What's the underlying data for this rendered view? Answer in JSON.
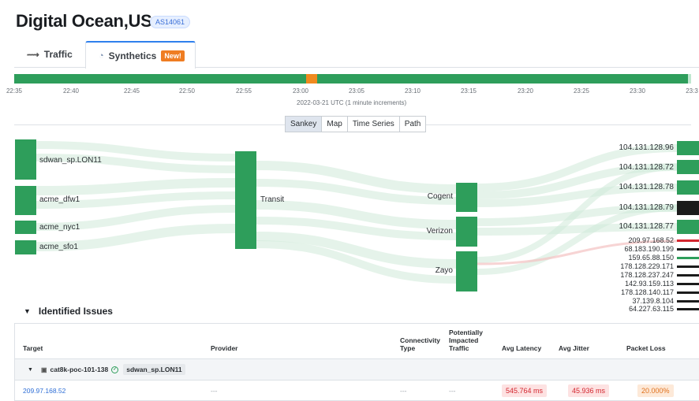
{
  "header": {
    "title": "Digital Ocean,US",
    "asn_badge": "AS14061",
    "tabs": [
      {
        "label": "Traffic",
        "icon": "traffic-icon"
      },
      {
        "label": "Synthetics",
        "icon": "synthetics-icon",
        "badge": "New!"
      }
    ]
  },
  "timeline": {
    "ticks": [
      "22:35",
      "22:40",
      "22:45",
      "22:50",
      "22:55",
      "23:00",
      "23:05",
      "23:10",
      "23:15",
      "23:20",
      "23:25",
      "23:30",
      "23:3"
    ],
    "axis_label": "2022-03-21 UTC (1 minute increments)"
  },
  "view_tabs": [
    "Sankey",
    "Map",
    "Time Series",
    "Path"
  ],
  "sankey": {
    "sources": [
      "sdwan_sp.LON11",
      "acme_dfw1",
      "acme_nyc1",
      "acme_sfo1"
    ],
    "middle": "Transit",
    "providers": [
      "Cogent",
      "Verizon",
      "Zayo"
    ],
    "targets_major": [
      "104.131.128.96",
      "104.131.128.72",
      "104.131.128.78",
      "104.131.128.79",
      "104.131.128.77"
    ],
    "targets_minor": [
      "209.97.168.52",
      "68.183.190.199",
      "159.65.88.150",
      "178.128.229.171",
      "178.128.237.247",
      "142.93.159.113",
      "178.128.140.117",
      "37.139.8.104",
      "64.227.63.115"
    ]
  },
  "issues": {
    "title": "Identified Issues",
    "columns": {
      "target": "Target",
      "provider": "Provider",
      "connectivity_1": "Connectivity",
      "connectivity_2": "Type",
      "impacted_1": "Potentially",
      "impacted_2": "Impacted",
      "impacted_3": "Traffic",
      "latency": "Avg Latency",
      "jitter": "Avg Jitter",
      "loss": "Packet Loss"
    },
    "group": {
      "device": "cat8k-poc-101-138",
      "site": "sdwan_sp.LON11"
    },
    "row": {
      "target": "209.97.168.52",
      "provider": "---",
      "connectivity": "---",
      "impacted": "---",
      "latency": "545.764 ms",
      "jitter": "45.936 ms",
      "loss": "20.000%"
    }
  },
  "colors": {
    "accent": "#2f80ed",
    "healthy": "#2e9e5b",
    "selected_time": "#f08a1f",
    "critical": "#d3262f",
    "warning": "#e0701c"
  }
}
